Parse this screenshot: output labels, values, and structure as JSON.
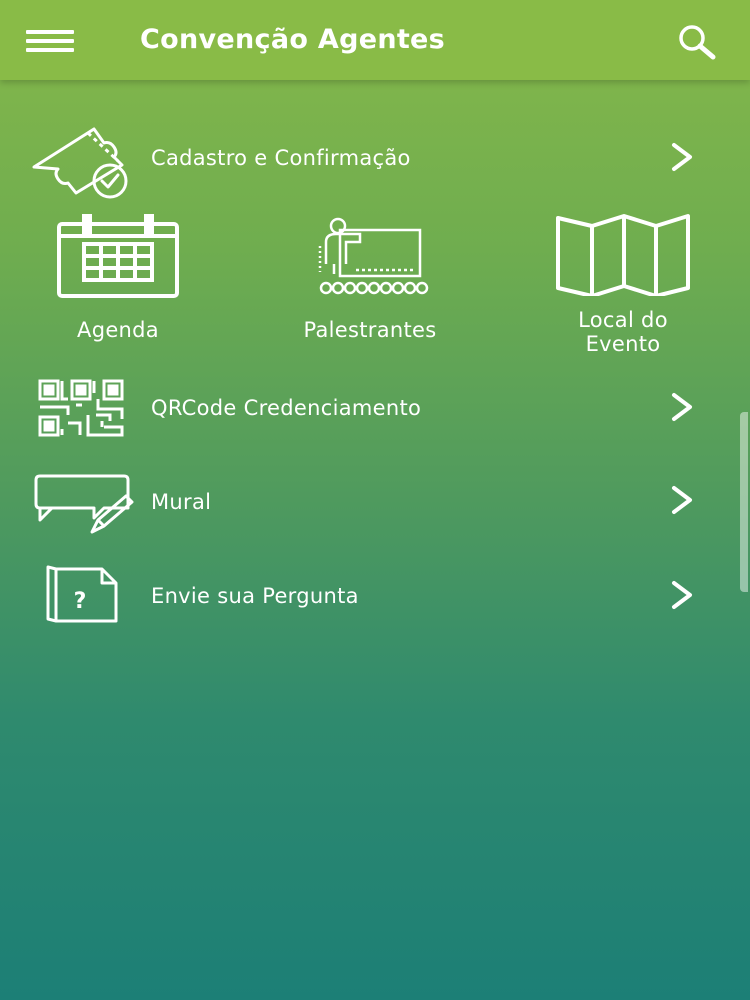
{
  "app_bar": {
    "title": "Convenção Agentes",
    "menu_icon": "hamburger-menu-icon",
    "search_icon": "search-icon"
  },
  "menu": {
    "cadastro": {
      "label": "Cadastro e Confirmação",
      "icon": "ticket-check-icon"
    },
    "tiles": [
      {
        "label": "Agenda",
        "icon": "calendar-icon"
      },
      {
        "label": "Palestrantes",
        "icon": "presentation-icon"
      },
      {
        "label_line1": "Local do",
        "label_line2": "Evento",
        "icon": "map-icon"
      }
    ],
    "qrcode": {
      "label": "QRCode Credenciamento",
      "icon": "qrcode-icon"
    },
    "mural": {
      "label": "Mural",
      "icon": "chat-bubble-pencil-icon"
    },
    "pergunta": {
      "label": "Envie sua Pergunta",
      "icon": "question-document-icon"
    }
  },
  "colors": {
    "app_bar": "#89bb47",
    "gradient_top": "#86b84a",
    "gradient_bottom": "#1c7f76",
    "foreground": "#ffffff"
  }
}
